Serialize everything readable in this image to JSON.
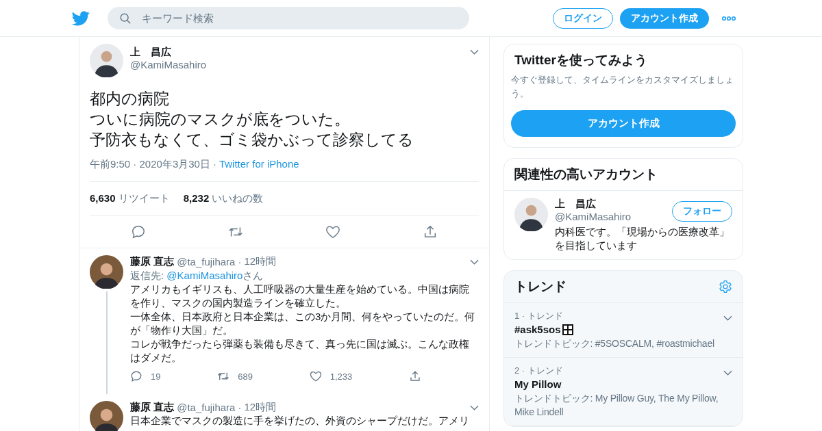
{
  "header": {
    "search": {
      "placeholder": "キーワード検索"
    },
    "login": "ログイン",
    "signup": "アカウント作成"
  },
  "tweet": {
    "name": "上　昌広",
    "handle": "@KamiMasahiro",
    "lines": [
      "都内の病院",
      "ついに病院のマスクが底をついた。",
      "予防衣もなくて、ゴミ袋かぶって診察してる"
    ],
    "time": "午前9:50 · 2020年3月30日",
    "separator": "·",
    "source": "Twitter for iPhone",
    "retweets": "6,630",
    "retweets_label": "リツイート",
    "likes": "8,232",
    "likes_label": "いいねの数"
  },
  "replies": [
    {
      "name": "藤原 直志",
      "handle": "@ta_fujihara",
      "dot": "·",
      "time": "12時間",
      "reply_to": {
        "prefix": "返信先: ",
        "handle": "@KamiMasahiro",
        "suffix": "さん"
      },
      "paragraphs": [
        "アメリカもイギリスも、人工呼吸器の大量生産を始めている。中国は病院を作り、マスクの国内製造ラインを確立した。",
        "一体全体、日本政府と日本企業は、この3か月間、何をやっていたのだ。何が「物作り大国」だ。",
        "コレが戦争だったら弾薬も装備も尽きて、真っ先に国は滅ぶ。こんな政権はダメだ。"
      ],
      "replies": "19",
      "retweets": "689",
      "likes": "1,233",
      "thread": true
    },
    {
      "name": "藤原 直志",
      "handle": "@ta_fujihara",
      "dot": "·",
      "time": "12時間",
      "paragraphs": [
        "日本企業でマスクの製造に手を挙げたの、外資のシャープだけだ。アメリ"
      ],
      "thread": false
    }
  ],
  "signup_card": {
    "title": "Twitterを使ってみよう",
    "text": "今すぐ登録して、タイムラインをカスタマイズしましょう。",
    "button": "アカウント作成"
  },
  "related": {
    "title": "関連性の高いアカウント",
    "accounts": [
      {
        "name": "上　昌広",
        "handle": "@KamiMasahiro",
        "follow": "フォロー",
        "bio": "内科医です。「現場からの医療改革」を目指しています"
      }
    ]
  },
  "trends": {
    "title": "トレンド",
    "items": [
      {
        "meta": "1 · トレンド",
        "name": "#ask5sos",
        "emoji": true,
        "topics": "トレンドトピック: #5SOSCALM, #roastmichael"
      },
      {
        "meta": "2 · トレンド",
        "name": "My Pillow",
        "emoji": false,
        "topics": "トレンドトピック: My Pillow Guy, The My Pillow, Mike Lindell"
      }
    ]
  }
}
